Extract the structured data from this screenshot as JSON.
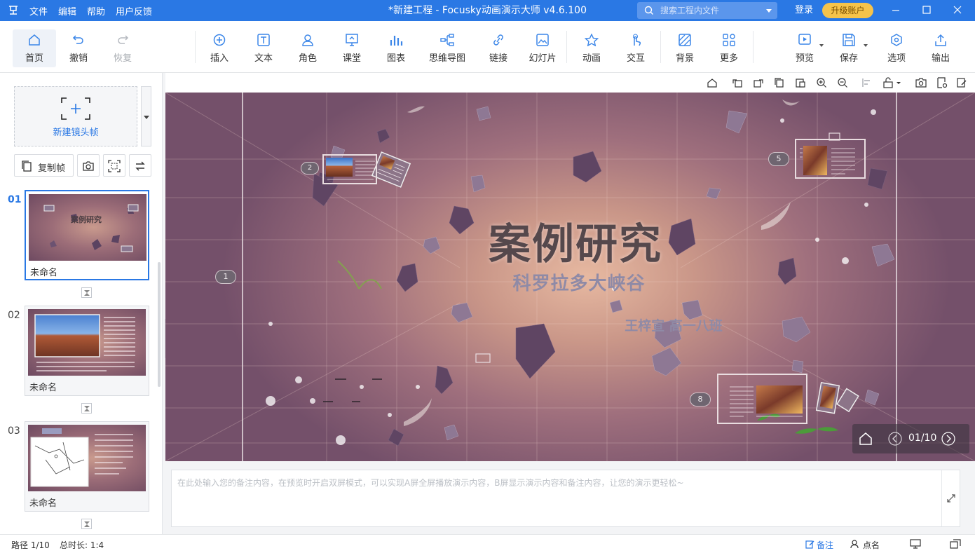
{
  "titlebar": {
    "menu": [
      "文件",
      "编辑",
      "帮助",
      "用户反馈"
    ],
    "window_title": "*新建工程 - Focusky动画演示大师  v4.6.100",
    "search_placeholder": "搜索工程内文件",
    "login": "登录",
    "upgrade": "升级账户"
  },
  "toolbar": {
    "home": "首页",
    "undo": "撤销",
    "redo": "恢复",
    "insert": "插入",
    "text": "文本",
    "role": "角色",
    "classroom": "课堂",
    "chart": "图表",
    "mindmap": "思维导图",
    "link": "链接",
    "slideshow": "幻灯片",
    "animation": "动画",
    "interact": "交互",
    "background": "背景",
    "more": "更多",
    "preview": "预览",
    "save": "保存",
    "options": "选项",
    "export": "输出"
  },
  "left": {
    "new_frame": "新建镜头帧",
    "copy_frame": "复制帧",
    "slides": [
      {
        "num": "01",
        "name": "未命名",
        "thumb_title": "案例研究"
      },
      {
        "num": "02",
        "name": "未命名"
      },
      {
        "num": "03",
        "name": "未命名"
      }
    ]
  },
  "canvas": {
    "title": "案例研究",
    "subtitle": "科罗拉多大峡谷",
    "author": "王梓宣   高一八班",
    "path_numbers": [
      "1",
      "2",
      "5",
      "8"
    ],
    "player_counter": "01/10"
  },
  "notes": {
    "placeholder": "在此处输入您的备注内容，在预览时开启双屏模式，可以实现A屏全屏播放演示内容，B屏显示演示内容和备注内容，让您的演示更轻松~"
  },
  "status": {
    "path": "路径 1/10",
    "duration": "总时长: 1:4",
    "notes": "备注",
    "rollcall": "点名"
  },
  "colors": {
    "accent": "#2a78e4",
    "upgrade": "#f6c34a",
    "canvas_center": "#e7b9a1",
    "canvas_edge": "#74506a"
  }
}
